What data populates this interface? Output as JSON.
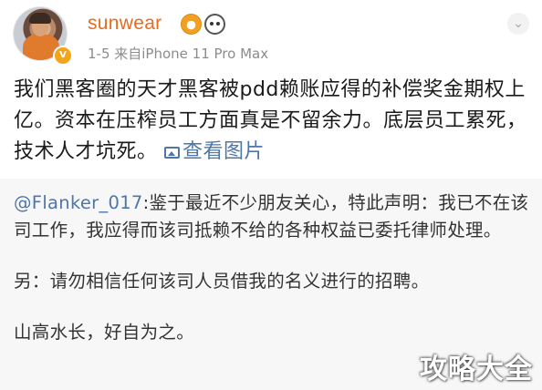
{
  "author": {
    "username": "sunwear",
    "username_color": "#e86b1f",
    "name_icons": [
      "mask-badge-icon",
      "panda-face-icon"
    ],
    "verified_badge": "V",
    "meta": "1-5  来自iPhone 11 Pro Max"
  },
  "post": {
    "text": "我们黑客圈的天才黑客被pdd赖账应得的补偿奖金期权上亿。资本在压榨员工方面真是不留余力。底层员工累死，技术人才坑死。",
    "view_image_label": "查看图片",
    "link_color": "#4f76a8"
  },
  "repost": {
    "mention": "@Flanker_017",
    "line1_rest": ":鉴于最近不少朋友关心，特此声明：我已不在该司工作，我应得而该司抵赖不给的各种权益已委托律师处理。",
    "line2": "另：请勿相信任何该司人员借我的名义进行的招聘。",
    "line3": "山高水长，好自为之。"
  },
  "watermark": {
    "text": "攻略大全"
  }
}
